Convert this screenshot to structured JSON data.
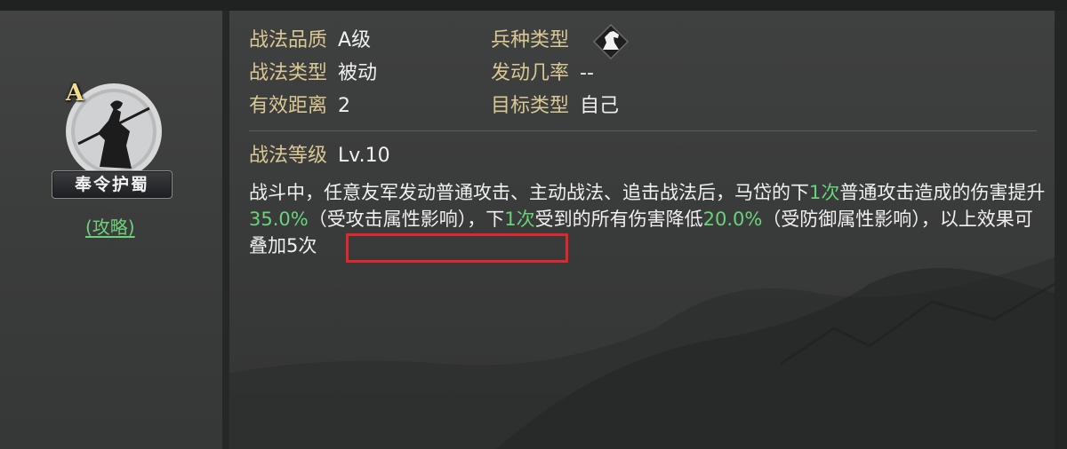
{
  "skill": {
    "grade_badge": "A",
    "name": "奉令护蜀",
    "strategy_link": "(攻略)"
  },
  "attributes": {
    "quality_label": "战法品质",
    "quality_value": "A级",
    "type_label": "战法类型",
    "type_value": "被动",
    "range_label": "有效距离",
    "range_value": "2",
    "troop_label": "兵种类型",
    "troop_icon": "horse-icon",
    "rate_label": "发动几率",
    "rate_value": "--",
    "target_label": "目标类型",
    "target_value": "自己",
    "level_label": "战法等级",
    "level_value": "Lv.10"
  },
  "description": {
    "p1": "战斗中，任意友军发动普通攻击、主动战法、追击战法后，马岱的下",
    "n1": "1次",
    "p2": "普通攻击造成的伤害提升",
    "n2": "35.0%",
    "p3": "（受攻击属性影响），下",
    "n3": "1次",
    "p4": "受到的所有伤害降低",
    "n4": "20.0%",
    "p5": "（受防御属性影响），",
    "p6": "以上效果可叠加5次"
  },
  "colors": {
    "label": "#d9c893",
    "value": "#f0f0f0",
    "highlight": "#69d37a",
    "annotation_box": "#e2262d"
  }
}
